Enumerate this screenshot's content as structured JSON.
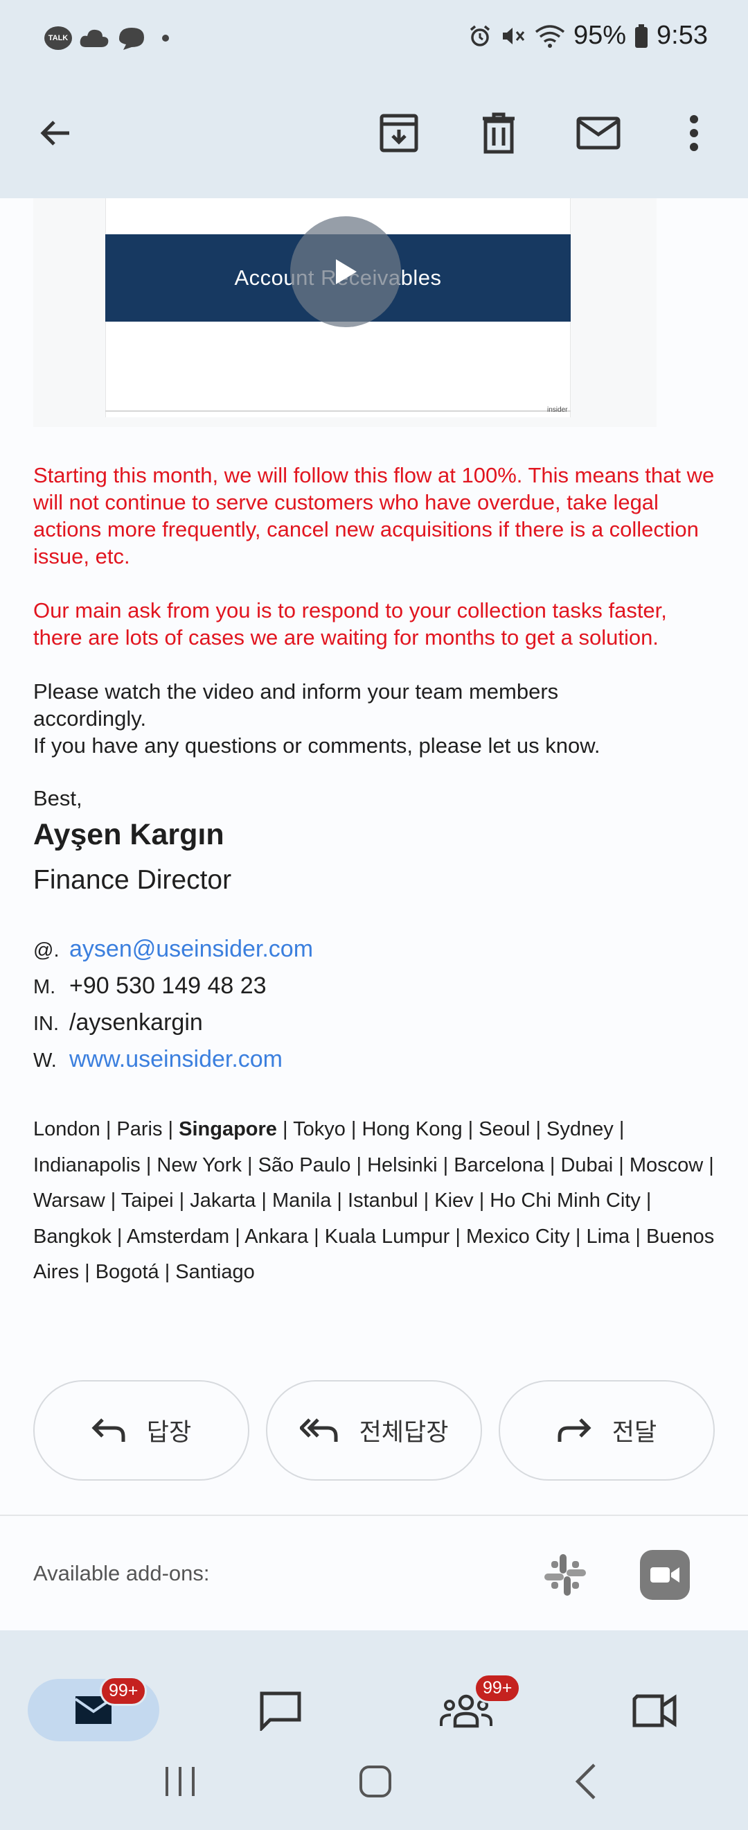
{
  "status_bar": {
    "talk_label": "TALK",
    "battery": "95%",
    "time": "9:53"
  },
  "email": {
    "video_title": "Account Receivables",
    "video_logo": "insider",
    "red_paragraph_1": "Starting this month, we will follow this flow at 100%. This means that we will not continue to serve customers who have overdue, take legal actions more frequently, cancel new acquisitions if there is a collection issue, etc.",
    "red_paragraph_2": "Our main ask from you is to respond to your collection tasks faster, there are lots of cases we are waiting for months to get a solution.",
    "paragraph_3_line_1": "Please watch the video and inform your team members accordingly.",
    "paragraph_3_line_2": "If you have any questions or comments, please let us know.",
    "closing": "Best,",
    "signature": {
      "name": "Ayşen Kargın",
      "title": "Finance Director",
      "email_key": "@.",
      "email": "aysen@useinsider.com",
      "phone_key": "M.",
      "phone": "+90 530 149 48 23",
      "linkedin_key": "IN.",
      "linkedin": "/aysenkargin",
      "web_key": "W.",
      "web": "www.useinsider.com"
    },
    "cities_before": "London | Paris | ",
    "cities_bold": "Singapore",
    "cities_after": " | Tokyo | Hong Kong | Seoul | Sydney | Indianapolis | New York | São Paulo | Helsinki | Barcelona | Dubai | Moscow | Warsaw | Taipei | Jakarta | Manila | Istanbul | Kiev | Ho Chi Minh City | Bangkok | Amsterdam | Ankara | Kuala Lumpur | Mexico City | Lima | Buenos Aires | Bogotá | Santiago"
  },
  "actions": {
    "reply": "답장",
    "reply_all": "전체답장",
    "forward": "전달"
  },
  "addons": {
    "label": "Available add-ons:"
  },
  "bottom_nav": {
    "mail_badge": "99+",
    "meet_badge": "99+"
  },
  "icons": [
    "talk-icon",
    "cloud-icon",
    "chat-icon",
    "alarm-icon",
    "mute-icon",
    "wifi-icon",
    "battery-icon",
    "back-arrow-icon",
    "archive-icon",
    "trash-icon",
    "mail-icon",
    "more-icon",
    "play-icon",
    "reply-icon",
    "reply-all-icon",
    "forward-icon",
    "slack-icon",
    "video-call-icon",
    "chat-bubble-icon",
    "people-icon",
    "video-camera-icon"
  ],
  "colors": {
    "header_bg": "#e1eaf1",
    "red_text": "#e1151f",
    "link": "#3b7fde",
    "badge": "#c5221f",
    "video_banner": "#173961"
  }
}
